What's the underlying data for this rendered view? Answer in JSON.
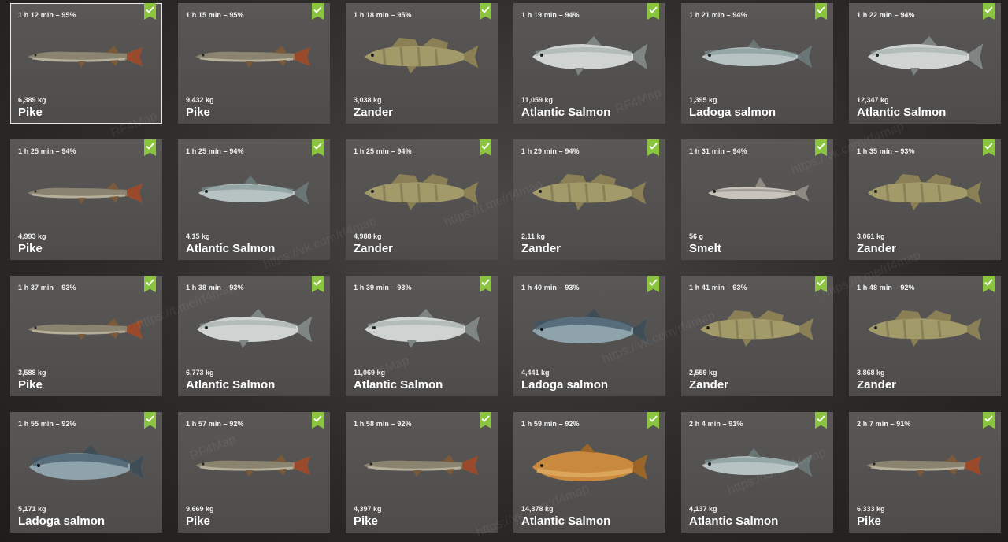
{
  "colors": {
    "background": "#2e2c2a",
    "card": "#555351",
    "check_badge": "#8bc43f",
    "text": "#ffffff"
  },
  "cards": [
    {
      "time": "1 h 12 min – 95%",
      "weight": "6,389 kg",
      "name": "Pike",
      "fish": "pike",
      "selected": true
    },
    {
      "time": "1 h 15 min – 95%",
      "weight": "9,432 kg",
      "name": "Pike",
      "fish": "pike"
    },
    {
      "time": "1 h 18 min – 95%",
      "weight": "3,038 kg",
      "name": "Zander",
      "fish": "zander"
    },
    {
      "time": "1 h 19 min – 94%",
      "weight": "11,059 kg",
      "name": "Atlantic Salmon",
      "fish": "salmon-silver"
    },
    {
      "time": "1 h 21 min – 94%",
      "weight": "1,395 kg",
      "name": "Ladoga salmon",
      "fish": "salmon-blue"
    },
    {
      "time": "1 h 22 min – 94%",
      "weight": "12,347 kg",
      "name": "Atlantic Salmon",
      "fish": "salmon-silver"
    },
    {
      "time": "1 h 25 min – 94%",
      "weight": "4,993 kg",
      "name": "Pike",
      "fish": "pike"
    },
    {
      "time": "1 h 25 min – 94%",
      "weight": "4,15 kg",
      "name": "Atlantic Salmon",
      "fish": "salmon-blue"
    },
    {
      "time": "1 h 25 min – 94%",
      "weight": "4,988 kg",
      "name": "Zander",
      "fish": "zander"
    },
    {
      "time": "1 h 29 min – 94%",
      "weight": "2,11 kg",
      "name": "Zander",
      "fish": "zander"
    },
    {
      "time": "1 h 31 min – 94%",
      "weight": "56 g",
      "name": "Smelt",
      "fish": "smelt"
    },
    {
      "time": "1 h 35 min – 93%",
      "weight": "3,061 kg",
      "name": "Zander",
      "fish": "zander"
    },
    {
      "time": "1 h 37 min – 93%",
      "weight": "3,588 kg",
      "name": "Pike",
      "fish": "pike"
    },
    {
      "time": "1 h 38 min – 93%",
      "weight": "6,773 kg",
      "name": "Atlantic Salmon",
      "fish": "salmon-silver"
    },
    {
      "time": "1 h 39 min – 93%",
      "weight": "11,069 kg",
      "name": "Atlantic Salmon",
      "fish": "salmon-silver"
    },
    {
      "time": "1 h 40 min – 93%",
      "weight": "4,441 kg",
      "name": "Ladoga salmon",
      "fish": "salmon-dark"
    },
    {
      "time": "1 h 41 min – 93%",
      "weight": "2,559 kg",
      "name": "Zander",
      "fish": "zander"
    },
    {
      "time": "1 h 48 min – 92%",
      "weight": "3,868 kg",
      "name": "Zander",
      "fish": "zander"
    },
    {
      "time": "1 h 55 min – 92%",
      "weight": "5,171 kg",
      "name": "Ladoga salmon",
      "fish": "salmon-dark"
    },
    {
      "time": "1 h 57 min – 92%",
      "weight": "9,669 kg",
      "name": "Pike",
      "fish": "pike"
    },
    {
      "time": "1 h 58 min – 92%",
      "weight": "4,397 kg",
      "name": "Pike",
      "fish": "pike"
    },
    {
      "time": "1 h 59 min – 92%",
      "weight": "14,378 kg",
      "name": "Atlantic Salmon",
      "fish": "salmon-gold"
    },
    {
      "time": "2 h 4 min – 91%",
      "weight": "4,137 kg",
      "name": "Atlantic Salmon",
      "fish": "salmon-blue"
    },
    {
      "time": "2 h 7 min – 91%",
      "weight": "6,333 kg",
      "name": "Pike",
      "fish": "pike"
    }
  ],
  "watermarks": [
    "RF4Map",
    "https://vk.com/rf4map",
    "https://t.me/rf4map"
  ]
}
